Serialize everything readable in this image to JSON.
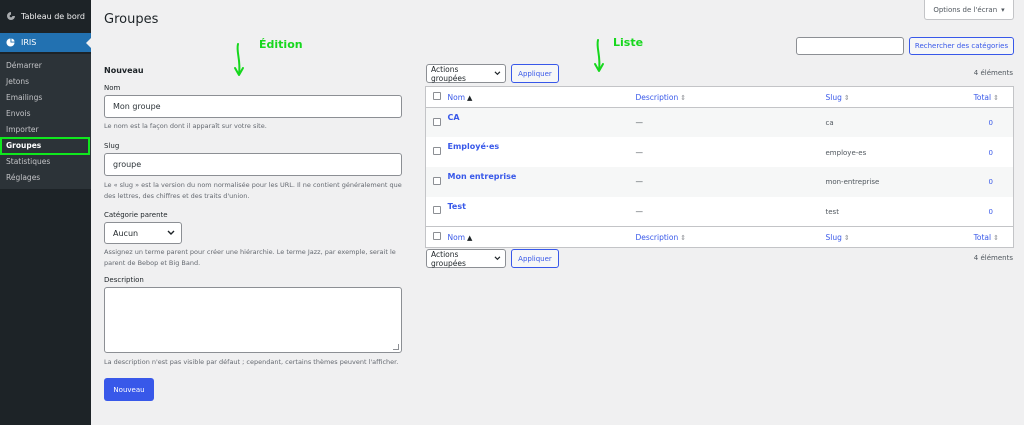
{
  "sidebar": {
    "dashboard_label": "Tableau de bord",
    "active_menu_label": "IRIS",
    "submenu": [
      "Démarrer",
      "Jetons",
      "Emailings",
      "Envois",
      "Importer",
      "Groupes",
      "Statistiques",
      "Réglages"
    ],
    "current_item": "Groupes"
  },
  "header": {
    "title": "Groupes",
    "screen_options": "Options de l'écran"
  },
  "annotations": {
    "edit": "Édition",
    "list": "Liste"
  },
  "form": {
    "heading": "Nouveau",
    "name_label": "Nom",
    "name_value": "Mon groupe",
    "name_help": "Le nom est la façon dont il apparaît sur votre site.",
    "slug_label": "Slug",
    "slug_value": "groupe",
    "slug_help_1": "Le « slug » est la version du nom normalisée pour les URL. Il ne contient généralement que",
    "slug_help_2": "des lettres, des chiffres et des traits d'union.",
    "parent_label": "Catégorie parente",
    "parent_value": "Aucun",
    "parent_help_1": "Assignez un terme parent pour créer une hiérarchie. Le terme Jazz, par exemple, serait le",
    "parent_help_2": "parent de Bebop et Big Band.",
    "description_label": "Description",
    "description_value": "",
    "description_help": "La description n'est pas visible par défaut ; cependant, certains thèmes peuvent l'afficher.",
    "submit_label": "Nouveau"
  },
  "search": {
    "value": "",
    "button_label": "Rechercher des catégories"
  },
  "bulk": {
    "select_label": "Actions groupées",
    "apply_label": "Appliquer",
    "count": "4 éléments"
  },
  "table": {
    "columns": [
      "Nom",
      "Description",
      "Slug",
      "Total"
    ],
    "rows": [
      {
        "name": "CA",
        "description": "—",
        "slug": "ca",
        "total": "0"
      },
      {
        "name": "Employé·es",
        "description": "—",
        "slug": "employe-es",
        "total": "0"
      },
      {
        "name": "Mon entreprise",
        "description": "—",
        "slug": "mon-entreprise",
        "total": "0"
      },
      {
        "name": "Test",
        "description": "—",
        "slug": "test",
        "total": "0"
      }
    ]
  },
  "colors": {
    "sidebar_bg": "#1d2327",
    "accent": "#3858e9",
    "highlight_green": "#10e81e"
  }
}
